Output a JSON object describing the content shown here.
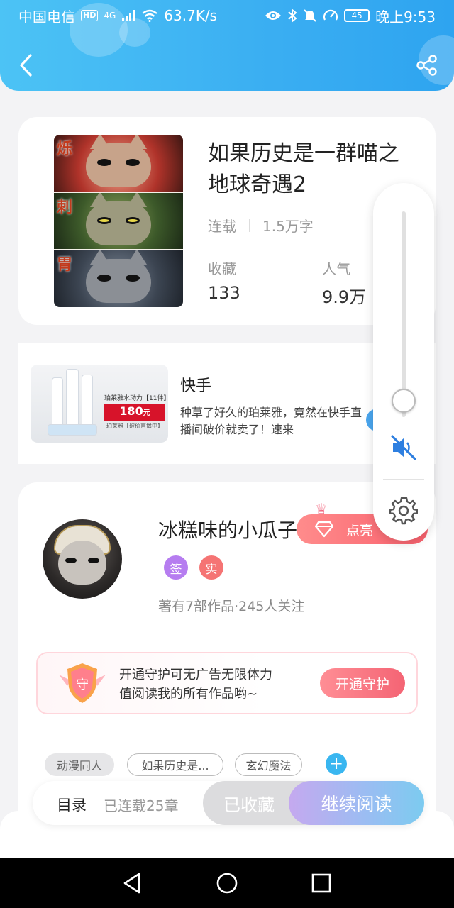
{
  "status_bar": {
    "carrier": "中国电信",
    "hd": "HD",
    "network": "4G",
    "speed": "63.7K/s",
    "battery": "45",
    "time": "晚上9:53"
  },
  "book": {
    "title": "如果历史是一群喵之地球奇遇2",
    "status": "连载",
    "word_count": "1.5万字",
    "collect_label": "收藏",
    "collect_value": "133",
    "popularity_label": "人气",
    "popularity_value": "9.9万",
    "cover_chars": [
      "烁",
      "刺",
      "胃"
    ]
  },
  "ad": {
    "source": "快手",
    "text": "种草了好久的珀莱雅，竟然在快手直播间破价就卖了！速来",
    "image_promo": "珀莱雅水动力【11件】",
    "image_price": "180",
    "image_price_unit": "元",
    "image_sub": "珀莱雅【破价直播中】"
  },
  "author": {
    "name": "冰糕味的小瓜子",
    "light_up_label": "点亮",
    "badge_sign": "签",
    "badge_real": "实",
    "stats": "著有7部作品·245人关注"
  },
  "guard": {
    "icon_char": "守",
    "text_line1": "开通守护可无广告无限体力",
    "text_line2": "值阅读我的所有作品哟~",
    "button": "开通守护"
  },
  "tags": [
    "动漫同人",
    "如果历史是...",
    "玄幻魔法"
  ],
  "bottom_bar": {
    "toc": "目录",
    "chapters": "已连载25章",
    "collected": "已收藏",
    "continue": "继续阅读"
  },
  "volume": {
    "level": 0.08,
    "muted": true
  },
  "colors": {
    "header_blue": "#3aaef2",
    "accent_pink": "#f46474",
    "tag_add_blue": "#39b6f0"
  }
}
